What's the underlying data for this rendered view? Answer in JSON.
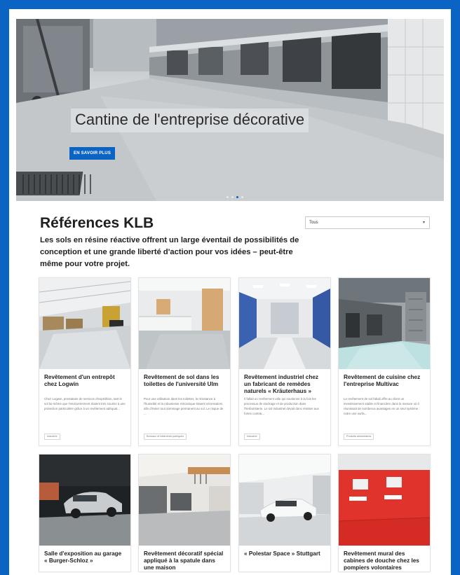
{
  "hero": {
    "title": "Cantine de l'entreprise décorative",
    "button_label": "EN SAVOIR PLUS",
    "slides": 4,
    "active_slide": 3
  },
  "section": {
    "title": "Références KLB",
    "intro": "Les sols en résine réactive offrent un large éventail de possibilités de conception et une grande liberté d'action pour vos idées – peut-être même pour votre projet."
  },
  "filter": {
    "selected": "Tous",
    "caret_icon": "chevron-down-icon"
  },
  "colors": {
    "brand_blue": "#0b63c4",
    "text": "#1f1f1f",
    "muted": "#777777"
  },
  "cards": [
    {
      "title": "Revêtement d'un entrepôt chez Logwin",
      "desc": "Chez Logwin, prestataire de services d'expédition, tant le sol lui-même que l'environnement étaient très soumis à une protection particulière grâce à un revêtement adéquat...",
      "tag": "Industrie"
    },
    {
      "title": "Revêtement de sol dans les toilettes de l'université Ulm",
      "desc": "Pour une utilisation dans les toilettes, la résistance à l'humidité et la robustesse mécanique étaient nécessaires afin d'éviter tout dommage permanent au sol. Le risque de ...",
      "tag": "Bureaux et bâtiments publiques"
    },
    {
      "title": "Revêtement industriel chez un fabricant de remèdes naturels « Kräuterhaus »",
      "desc": "Il fallait un revêtement utile qui soutienne à la fois les processus de stockage et de production dans l'herboristerie. Le sol industriel devait donc résister aux fortes contrai...",
      "tag": "Industrie"
    },
    {
      "title": "Revêtement de cuisine chez l'entreprise Multivac",
      "desc": "Le revêtement de sol fabali offre au client un investissement stable et financière dans la mesure où il réunissait de nombreux avantages en un seul système : notre une surfa...",
      "tag": "Produits alimentaires"
    },
    {
      "title": "Salle d'exposition au garage « Burger-Schloz »",
      "desc": "",
      "tag": ""
    },
    {
      "title": "Revêtement décoratif spécial appliqué à la spatule dans une maison",
      "desc": "",
      "tag": ""
    },
    {
      "title": "« Polestar Space » Stuttgart",
      "desc": "",
      "tag": ""
    },
    {
      "title": "Revêtement mural des cabines de douche chez les pompiers volontaires",
      "desc": "",
      "tag": ""
    }
  ]
}
